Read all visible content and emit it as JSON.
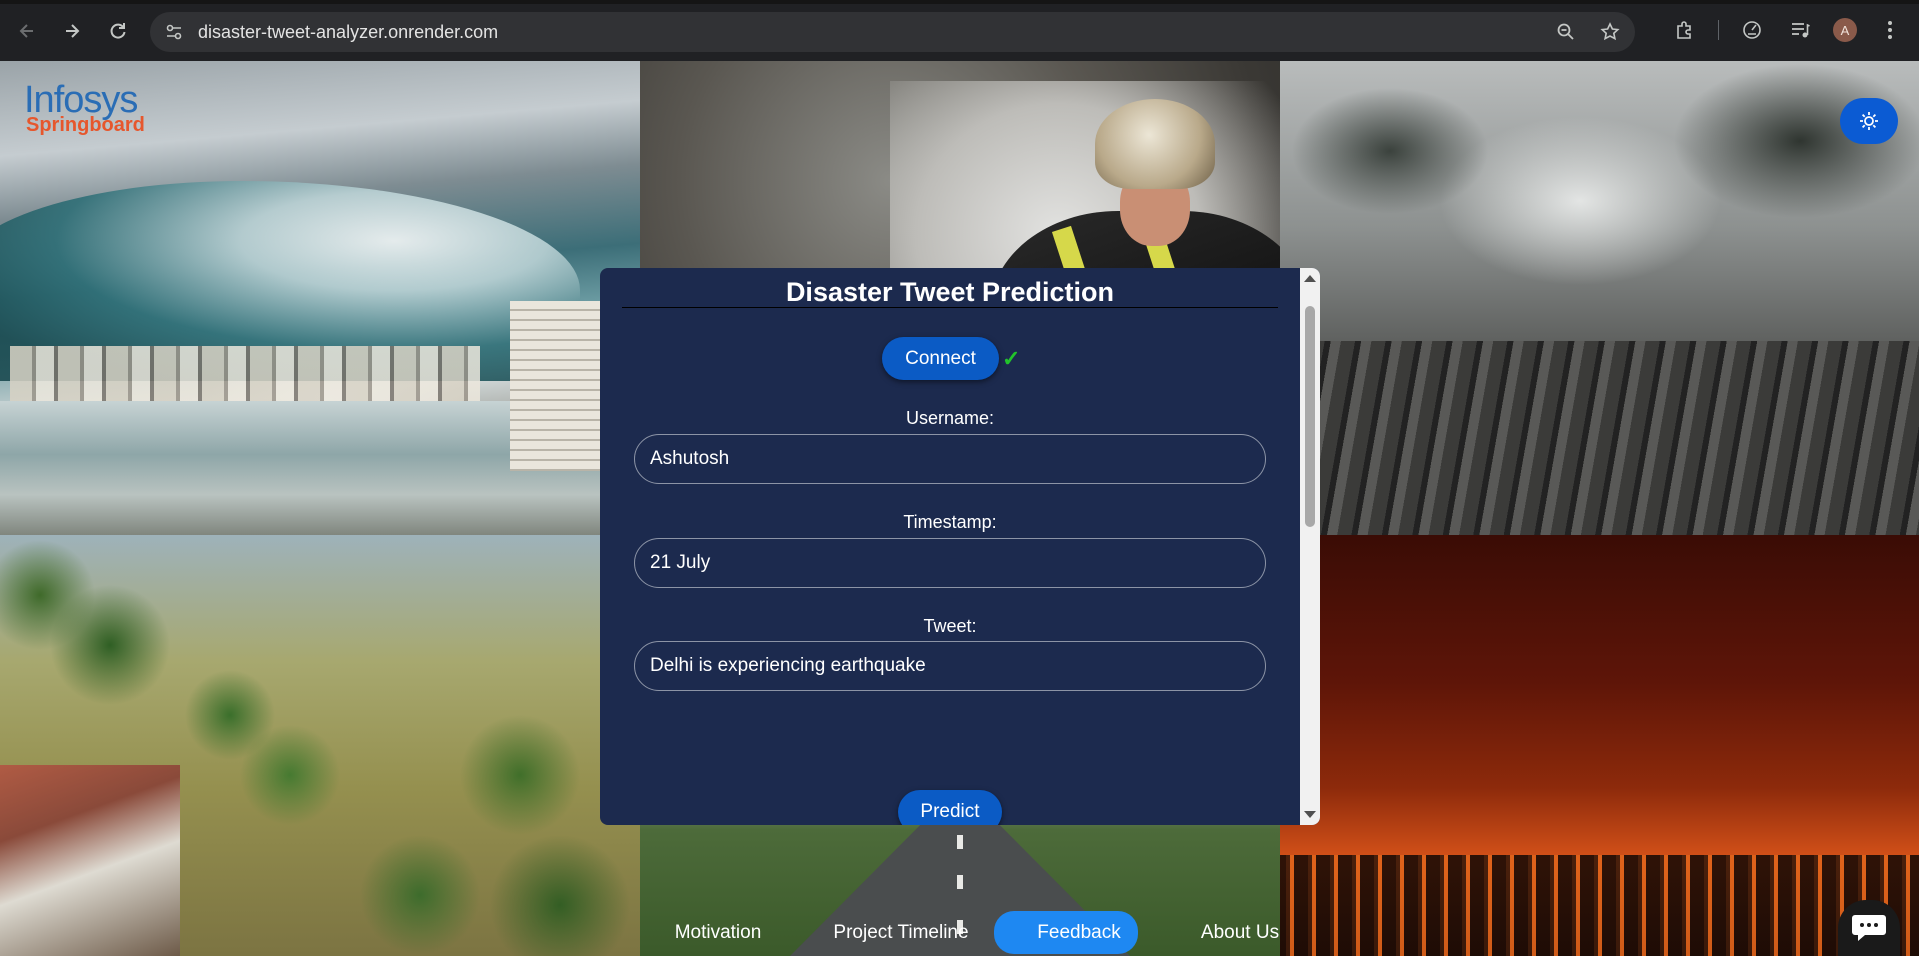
{
  "browser": {
    "url": "disaster-tweet-analyzer.onrender.com",
    "profile_initial": "A",
    "icons": {
      "back": "arrow-left-icon",
      "forward": "arrow-right-icon",
      "reload": "reload-icon",
      "site_info": "tune-icon",
      "zoom": "zoom-icon",
      "bookmark": "star-icon",
      "extensions": "puzzle-icon",
      "performance": "gauge-icon",
      "media": "playlist-icon",
      "menu": "kebab-menu-icon"
    }
  },
  "logo": {
    "line1": "Infosys",
    "line2": "Springboard",
    "colors": {
      "line1": "#2a6db5",
      "line2": "#e6572d"
    }
  },
  "theme_toggle": {
    "icon": "sun-icon",
    "color": "#0b5bd3"
  },
  "form": {
    "title": "Disaster Tweet Prediction",
    "connect_label": "Connect",
    "connected_mark": "✓",
    "username_label": "Username:",
    "username_value": "Ashutosh",
    "timestamp_label": "Timestamp:",
    "timestamp_value": "21 July",
    "tweet_label": "Tweet:",
    "tweet_value": "Delhi is experiencing earthquake",
    "predict_label": "Predict",
    "colors": {
      "panel": "#1c2a4e",
      "button": "#0b5bc5",
      "check": "#22c32b"
    }
  },
  "footer_nav": {
    "items": [
      {
        "label": "Motivation",
        "active": false
      },
      {
        "label": "Project Timeline",
        "active": false
      },
      {
        "label": "Feedback",
        "active": true
      },
      {
        "label": "About Us",
        "active": false
      }
    ],
    "active_color": "#1e88f2"
  },
  "chat": {
    "icon": "chat-bubble-icon"
  }
}
